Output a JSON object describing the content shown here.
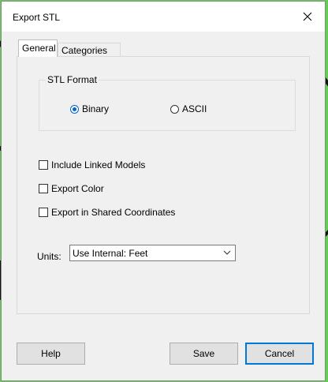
{
  "window": {
    "title": "Export STL",
    "close_icon": "close-icon"
  },
  "tabs": [
    {
      "label": "General",
      "active": true
    },
    {
      "label": "Categories",
      "active": false
    }
  ],
  "stl_format": {
    "group_label": "STL Format",
    "options": [
      {
        "label": "Binary",
        "checked": true
      },
      {
        "label": "ASCII",
        "checked": false
      }
    ]
  },
  "options": [
    {
      "label": "Include Linked Models",
      "checked": false
    },
    {
      "label": "Export Color",
      "checked": false
    },
    {
      "label": "Export in Shared Coordinates",
      "checked": false
    }
  ],
  "units": {
    "label": "Units:",
    "selected": "Use Internal: Feet"
  },
  "buttons": {
    "help": "Help",
    "save": "Save",
    "cancel": "Cancel"
  },
  "colors": {
    "accent": "#0078d7",
    "backdrop": "#5fd14f"
  }
}
